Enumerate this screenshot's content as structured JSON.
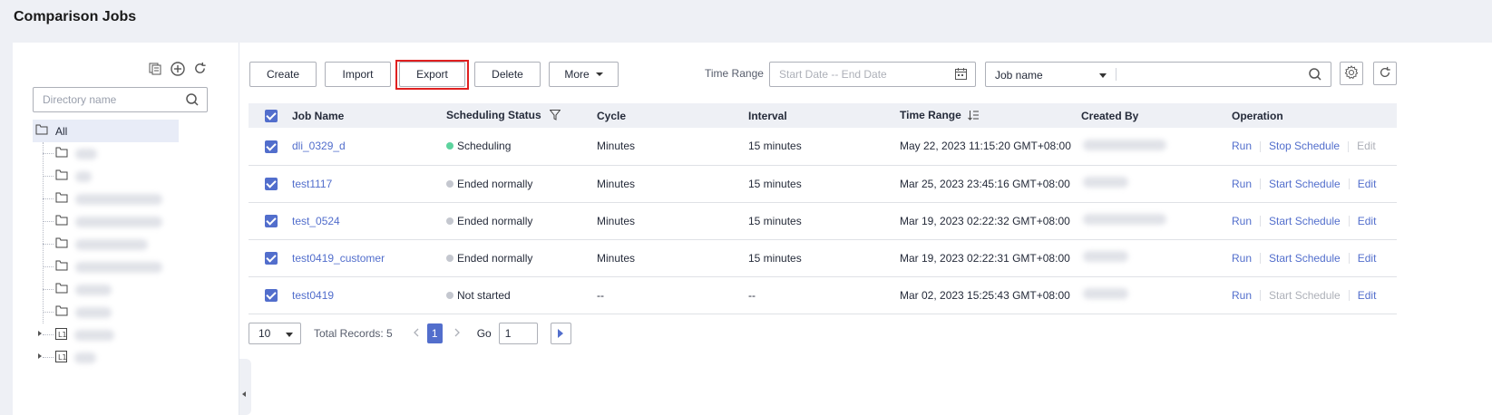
{
  "page": {
    "title": "Comparison Jobs"
  },
  "sidebar": {
    "search_placeholder": "Directory name",
    "root_label": "All"
  },
  "toolbar": {
    "create_label": "Create",
    "import_label": "Import",
    "export_label": "Export",
    "delete_label": "Delete",
    "more_label": "More",
    "time_range_label": "Time Range",
    "date_placeholder": "Start Date -- End Date",
    "search_field": "Job name"
  },
  "table": {
    "headers": {
      "job_name": "Job Name",
      "scheduling_status": "Scheduling Status",
      "cycle": "Cycle",
      "interval": "Interval",
      "time_range": "Time Range",
      "created_by": "Created By",
      "operation": "Operation"
    },
    "rows": [
      {
        "job_name": "dli_0329_d",
        "status": "Scheduling",
        "cycle": "Minutes",
        "interval": "15 minutes",
        "time_range": "May 22, 2023 11:15:20 GMT+08:00",
        "op_run": "Run",
        "op_schedule": "Stop Schedule",
        "op_edit": "Edit"
      },
      {
        "job_name": "test1117",
        "status": "Ended normally",
        "cycle": "Minutes",
        "interval": "15 minutes",
        "time_range": "Mar 25, 2023 23:45:16 GMT+08:00",
        "op_run": "Run",
        "op_schedule": "Start Schedule",
        "op_edit": "Edit"
      },
      {
        "job_name": "test_0524",
        "status": "Ended normally",
        "cycle": "Minutes",
        "interval": "15 minutes",
        "time_range": "Mar 19, 2023 02:22:32 GMT+08:00",
        "op_run": "Run",
        "op_schedule": "Start Schedule",
        "op_edit": "Edit"
      },
      {
        "job_name": "test0419_customer",
        "status": "Ended normally",
        "cycle": "Minutes",
        "interval": "15 minutes",
        "time_range": "Mar 19, 2023 02:22:31 GMT+08:00",
        "op_run": "Run",
        "op_schedule": "Start Schedule",
        "op_edit": "Edit"
      },
      {
        "job_name": "test0419",
        "status": "Not started",
        "cycle": "--",
        "interval": "--",
        "time_range": "Mar 02, 2023 15:25:43 GMT+08:00",
        "op_run": "Run",
        "op_schedule": "Start Schedule",
        "op_edit": "Edit"
      }
    ]
  },
  "pagination": {
    "page_size": "10",
    "total_label": "Total Records: 5",
    "current_page": "1",
    "go_label": "Go",
    "go_value": "1"
  },
  "colors": {
    "accent": "#526ecc",
    "status_running": "#5dd39e",
    "status_idle": "#c4c7cf",
    "highlight": "#e02020"
  }
}
